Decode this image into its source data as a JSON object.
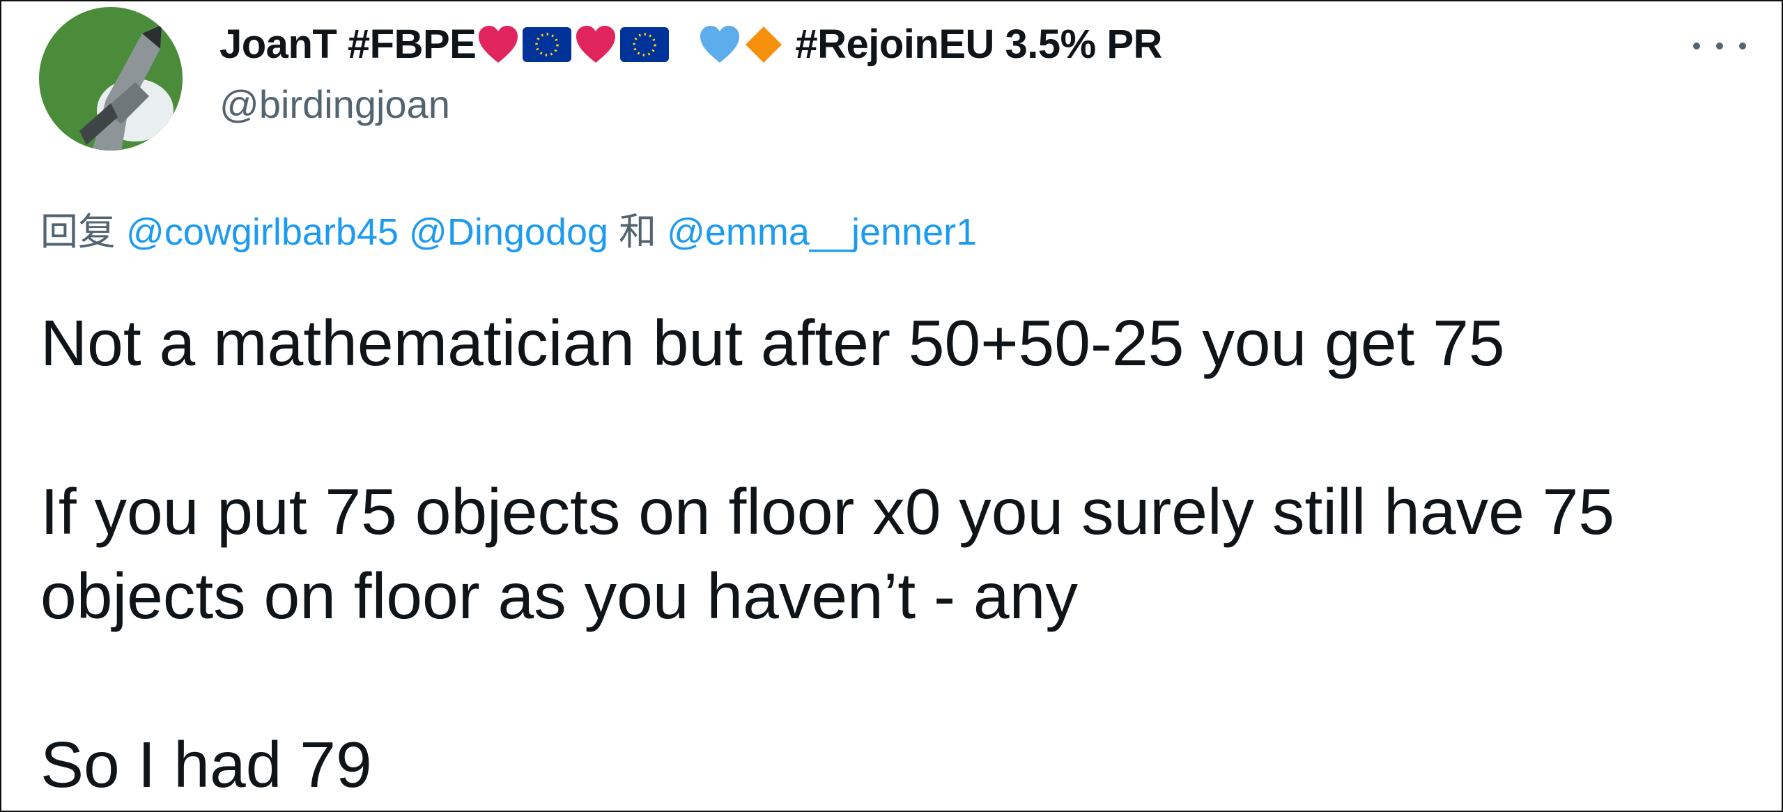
{
  "author": {
    "display_name_prefix": "JoanT #FBPE",
    "display_name_suffix": "#RejoinEU 3.5% PR",
    "name_emojis": [
      "red-heart-icon",
      "eu-flag-icon",
      "red-heart-icon",
      "eu-flag-icon",
      "blue-heart-icon",
      "orange-diamond-icon"
    ],
    "handle": "@birdingjoan",
    "avatar_icon": "bird-avatar-icon"
  },
  "reply": {
    "prefix": "回复",
    "mentions": [
      "@cowgirlbarb45",
      "@Dingodog",
      "@emma__jenner1"
    ],
    "conjunction": "和"
  },
  "tweet": {
    "line1": "Not a mathematician but after 50+50-25 you get 75",
    "line2": "If you put 75 objects on floor x0 you surely still have 75",
    "line3": "objects on floor as you haven’t - any",
    "line4": "So I had 79"
  },
  "colors": {
    "text": "#0f1419",
    "muted": "#536471",
    "link": "#1d9bf0",
    "avatar_bg": "#4a8c3a",
    "heart_red": "#e0245e",
    "heart_blue": "#5dadec",
    "eu_blue": "#003399",
    "diamond_orange": "#f4900c"
  },
  "icons": {
    "more": "more-options-icon"
  }
}
